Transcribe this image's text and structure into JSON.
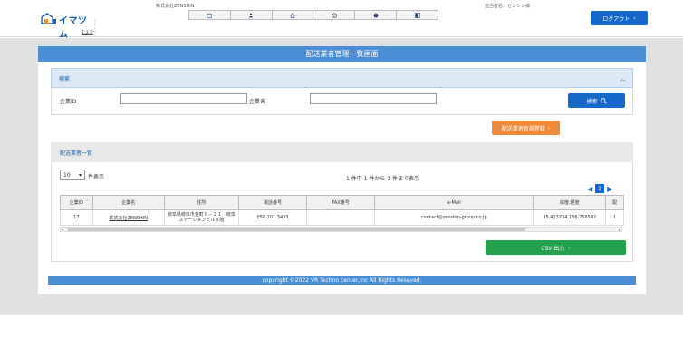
{
  "header": {
    "logo_text": "イマツム",
    "logo_tagline": "ラストワンマイル配送管理",
    "version": "1.1.0",
    "company": "株式会社ZENSHIN",
    "user": "担当者名：ゼンシン様",
    "logout_label": "ログアウト",
    "nav_icons": [
      "calendar-icon",
      "people-icon",
      "home-icon",
      "package-icon",
      "user-circle-icon",
      "book-icon"
    ]
  },
  "page": {
    "title": "配送業者管理一覧画面"
  },
  "search": {
    "section_label": "検索",
    "company_id_label": "企業ID",
    "company_id_value": "",
    "company_name_label": "企業名",
    "company_name_value": "",
    "search_button_label": "検索"
  },
  "register_button_label": "配送業者新規登録",
  "list": {
    "section_label": "配送業者一覧",
    "per_page_value": "10",
    "per_page_label": "件表示",
    "count_text": "1 件中 1 件から 1 件まで表示",
    "current_page": "1",
    "columns": [
      "企業ID",
      "企業名",
      "住所",
      "電話番号",
      "FAX番号",
      "e-Mail",
      "緯度,経度",
      "配"
    ],
    "rows": [
      [
        "17",
        "株式会社ZENSHIN",
        "岐阜県岐阜市金町６－２１　岐阜ステーションビル８階",
        "058 201 3433",
        "",
        "contact@zenshin-group.co.jp",
        "35.413734,136.756502",
        "1"
      ]
    ],
    "csv_button_label": "CSV 出力"
  },
  "footer": {
    "copyright": "copyright ©2022 VR Techno center,Inc All Rights Reseved."
  },
  "colors": {
    "primary": "#1469c8",
    "title_bar": "#4a8fd6",
    "register": "#ee8a3c",
    "csv": "#22a14a"
  }
}
